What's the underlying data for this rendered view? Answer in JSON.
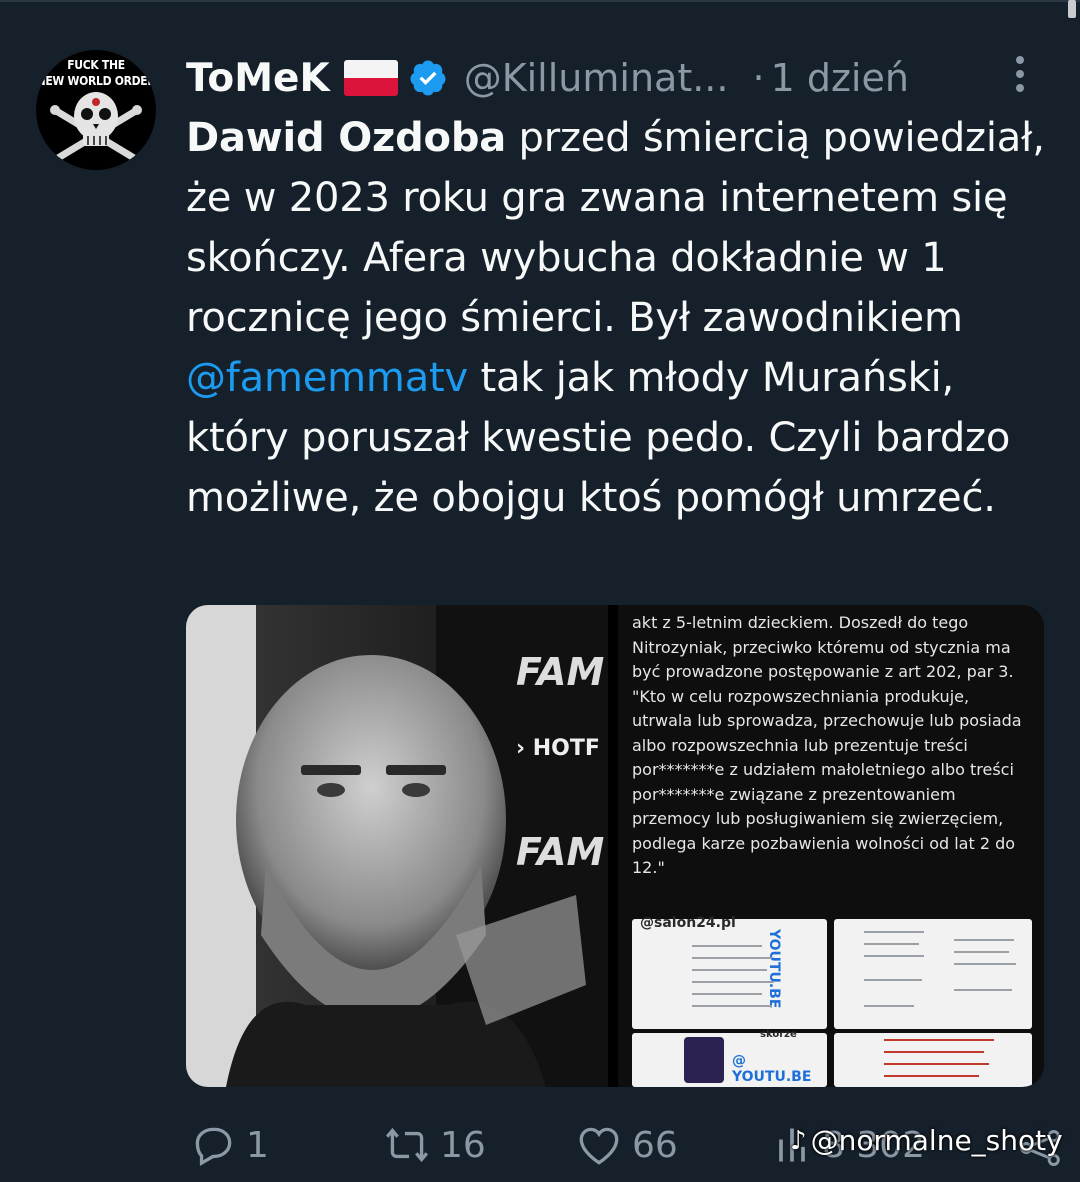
{
  "avatar": {
    "line1": "FUCK THE",
    "line2": "NEW WORLD ORDER"
  },
  "tweet": {
    "name": "ToMeK",
    "handle": "@Killuminat...",
    "separator": "·",
    "time": "1 dzień",
    "text": {
      "bold": "Dawid Ozdoba",
      "part1": " przed śmiercią powiedział, że w 2023 roku gra zwana internetem się skończy. Afera wybucha dokładnie w 1 rocznicę jego śmierci. Był zawodnikiem ",
      "mention": "@famemmatv",
      "part2": " tak jak młody Murański, który poruszał kwestie pedo. Czyli bardzo możliwe, że obojgu ktoś pomógł umrzeć."
    }
  },
  "media": {
    "screenshot_text": "akt z 5-letnim dzieckiem. Doszedł do tego Nitrozyniak, przeciwko któremu od stycznia ma być prowadzone postępowanie z art 202, par 3.\n\"Kto w celu rozpowszechniania produkuje, utrwala lub sprowadza, przechowuje lub posiada albo rozpowszechnia lub prezentuje treści por*******e z udziałem małoletniego albo treści por*******e związane z prezentowaniem przemocy lub posługiwaniem się zwierzęciem, podlega karze pozbawienia wolności od lat 2 do 12.\"",
    "thumb_label_1": "@salon24.pl",
    "thumb_label_2": "@ YOUTU.BE",
    "thumb_label_3": "YOUTU.BE",
    "thumb_label_4": "skorze"
  },
  "actions": {
    "replies": "1",
    "retweets": "16",
    "likes": "66",
    "views": "8 302"
  },
  "watermark": "@normalne_shoty",
  "colors": {
    "background": "#15202b",
    "accent": "#1d9bf0",
    "muted": "#8b98a5"
  }
}
